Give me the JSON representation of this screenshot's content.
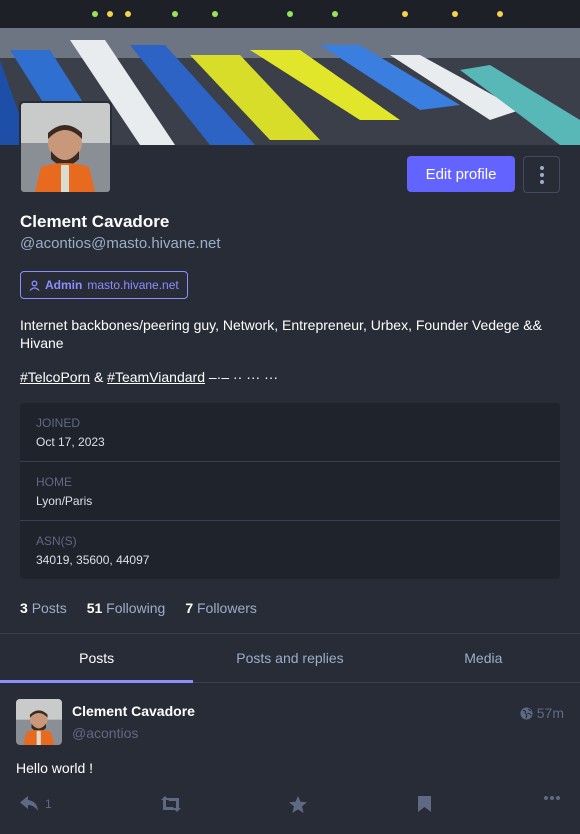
{
  "profile": {
    "display_name": "Clement Cavadore",
    "acct": "@acontios@masto.hivane.net",
    "edit_label": "Edit profile",
    "role": {
      "name": "Admin",
      "domain": "masto.hivane.net"
    },
    "bio_line1": "Internet backbones/peering guy, Network, Entrepreneur, Urbex, Founder Vedege && Hivane",
    "hashtag1": "#TelcoPorn",
    "amp": "&",
    "hashtag2": "#TeamViandard",
    "bio_tail": "–·– ·· ··· ···",
    "fields": [
      {
        "key": "JOINED",
        "value": "Oct 17, 2023"
      },
      {
        "key": "HOME",
        "value": "Lyon/Paris"
      },
      {
        "key": "ASN(S)",
        "value": "34019, 35600, 44097"
      }
    ],
    "stats": {
      "posts_count": "3",
      "posts_label": "Posts",
      "following_count": "51",
      "following_label": "Following",
      "followers_count": "7",
      "followers_label": "Followers"
    }
  },
  "tabs": [
    "Posts",
    "Posts and replies",
    "Media"
  ],
  "post": {
    "name": "Clement Cavadore",
    "acct": "@acontios",
    "time": "57m",
    "text": "Hello world !",
    "reply_count": "1"
  },
  "colors": {
    "accent": "#6364ff",
    "background": "#282c37",
    "muted": "#9baec8"
  },
  "icons": [
    "user-icon",
    "globe-icon",
    "reply-icon",
    "boost-icon",
    "star-icon",
    "bookmark-icon",
    "more-icon"
  ]
}
